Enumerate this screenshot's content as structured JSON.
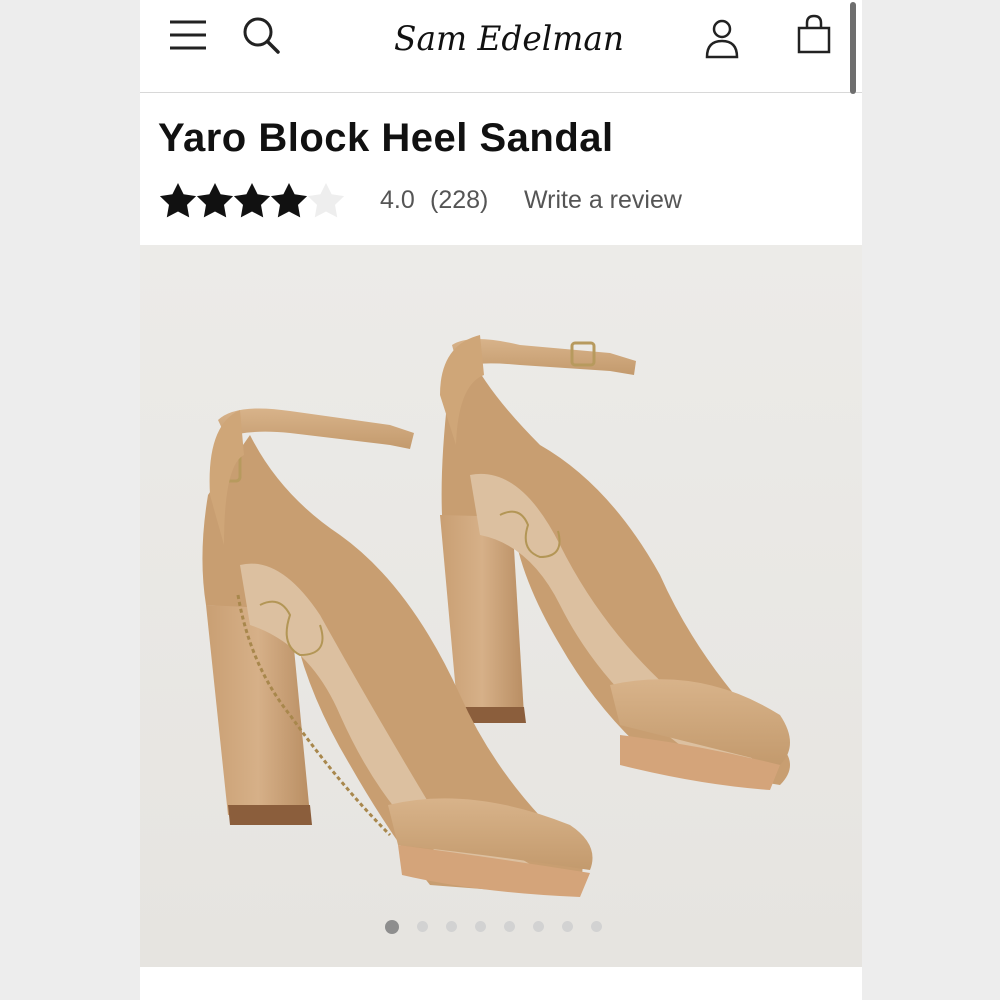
{
  "brand": {
    "logo_text": "Sam Edelman"
  },
  "header": {
    "icons": [
      "menu-icon",
      "search-icon",
      "account-icon",
      "bag-icon"
    ]
  },
  "product": {
    "title": "Yaro Block Heel Sandal",
    "rating": {
      "stars": 4,
      "max_stars": 5,
      "value": "4.0",
      "count": "(228)"
    },
    "review_link": "Write a review"
  },
  "gallery": {
    "image_count": 8,
    "active_index": 0
  },
  "colors": {
    "text": "#111111",
    "muted": "#555555",
    "shoe": "#d0ab82",
    "background": "#ececea"
  }
}
